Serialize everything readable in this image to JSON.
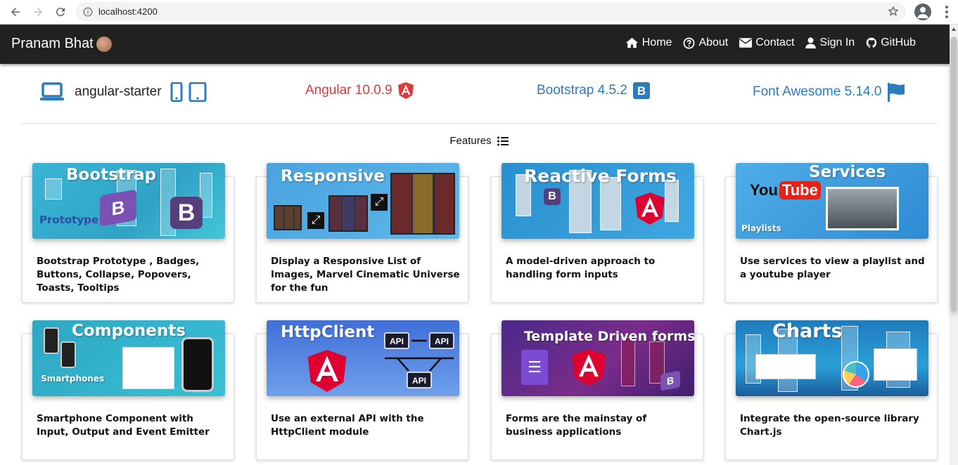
{
  "browser": {
    "url": "localhost:4200",
    "back_icon": "back-arrow-icon",
    "forward_icon": "forward-arrow-icon",
    "reload_icon": "reload-icon",
    "info_icon": "info-icon",
    "star_icon": "star-icon",
    "profile_icon": "profile-icon",
    "menu_icon": "kebab-menu-icon"
  },
  "navbar": {
    "brand": "Pranam Bhat",
    "links": [
      {
        "label": "Home",
        "icon": "home-icon"
      },
      {
        "label": "About",
        "icon": "question-circle-icon"
      },
      {
        "label": "Contact",
        "icon": "envelope-icon"
      },
      {
        "label": "Sign In",
        "icon": "user-icon"
      },
      {
        "label": "GitHub",
        "icon": "github-icon"
      }
    ]
  },
  "tech": {
    "starter": "angular-starter",
    "angular": "Angular 10.0.9",
    "bootstrap": "Bootstrap 4.5.2",
    "fontawesome": "Font Awesome 5.14.0"
  },
  "features_heading": "Features",
  "cards": [
    {
      "title": "Bootstrap",
      "sub": "Prototype",
      "text": "Bootstrap Prototype , Badges, Buttons, Collapse, Popovers, Toasts, Tooltips"
    },
    {
      "title": "Responsive",
      "text": "Display a Responsive List of Images, Marvel Cinematic Universe for the fun"
    },
    {
      "title": "Reactive Forms",
      "text": "A model-driven approach to handling form inputs"
    },
    {
      "title": "Services",
      "sub": "Playlists",
      "logo": "YouTube",
      "text": "Use services to view a playlist and a youtube player"
    },
    {
      "title": "Components",
      "sub": "Smartphones",
      "text": "Smartphone Component with Input, Output and Event Emitter"
    },
    {
      "title": "HttpClient",
      "api": "API",
      "text": "Use an external API with the HttpClient module"
    },
    {
      "title": "Template Driven forms",
      "text": "Forms are the mainstay of business applications"
    },
    {
      "title": "Charts",
      "text": "Integrate the open-source library Chart.js"
    }
  ],
  "colors": {
    "navbar": "#212121",
    "angular": "#dd3b3b",
    "link_blue": "#2b7bbd",
    "bootstrap_purple": "#563d7c"
  }
}
